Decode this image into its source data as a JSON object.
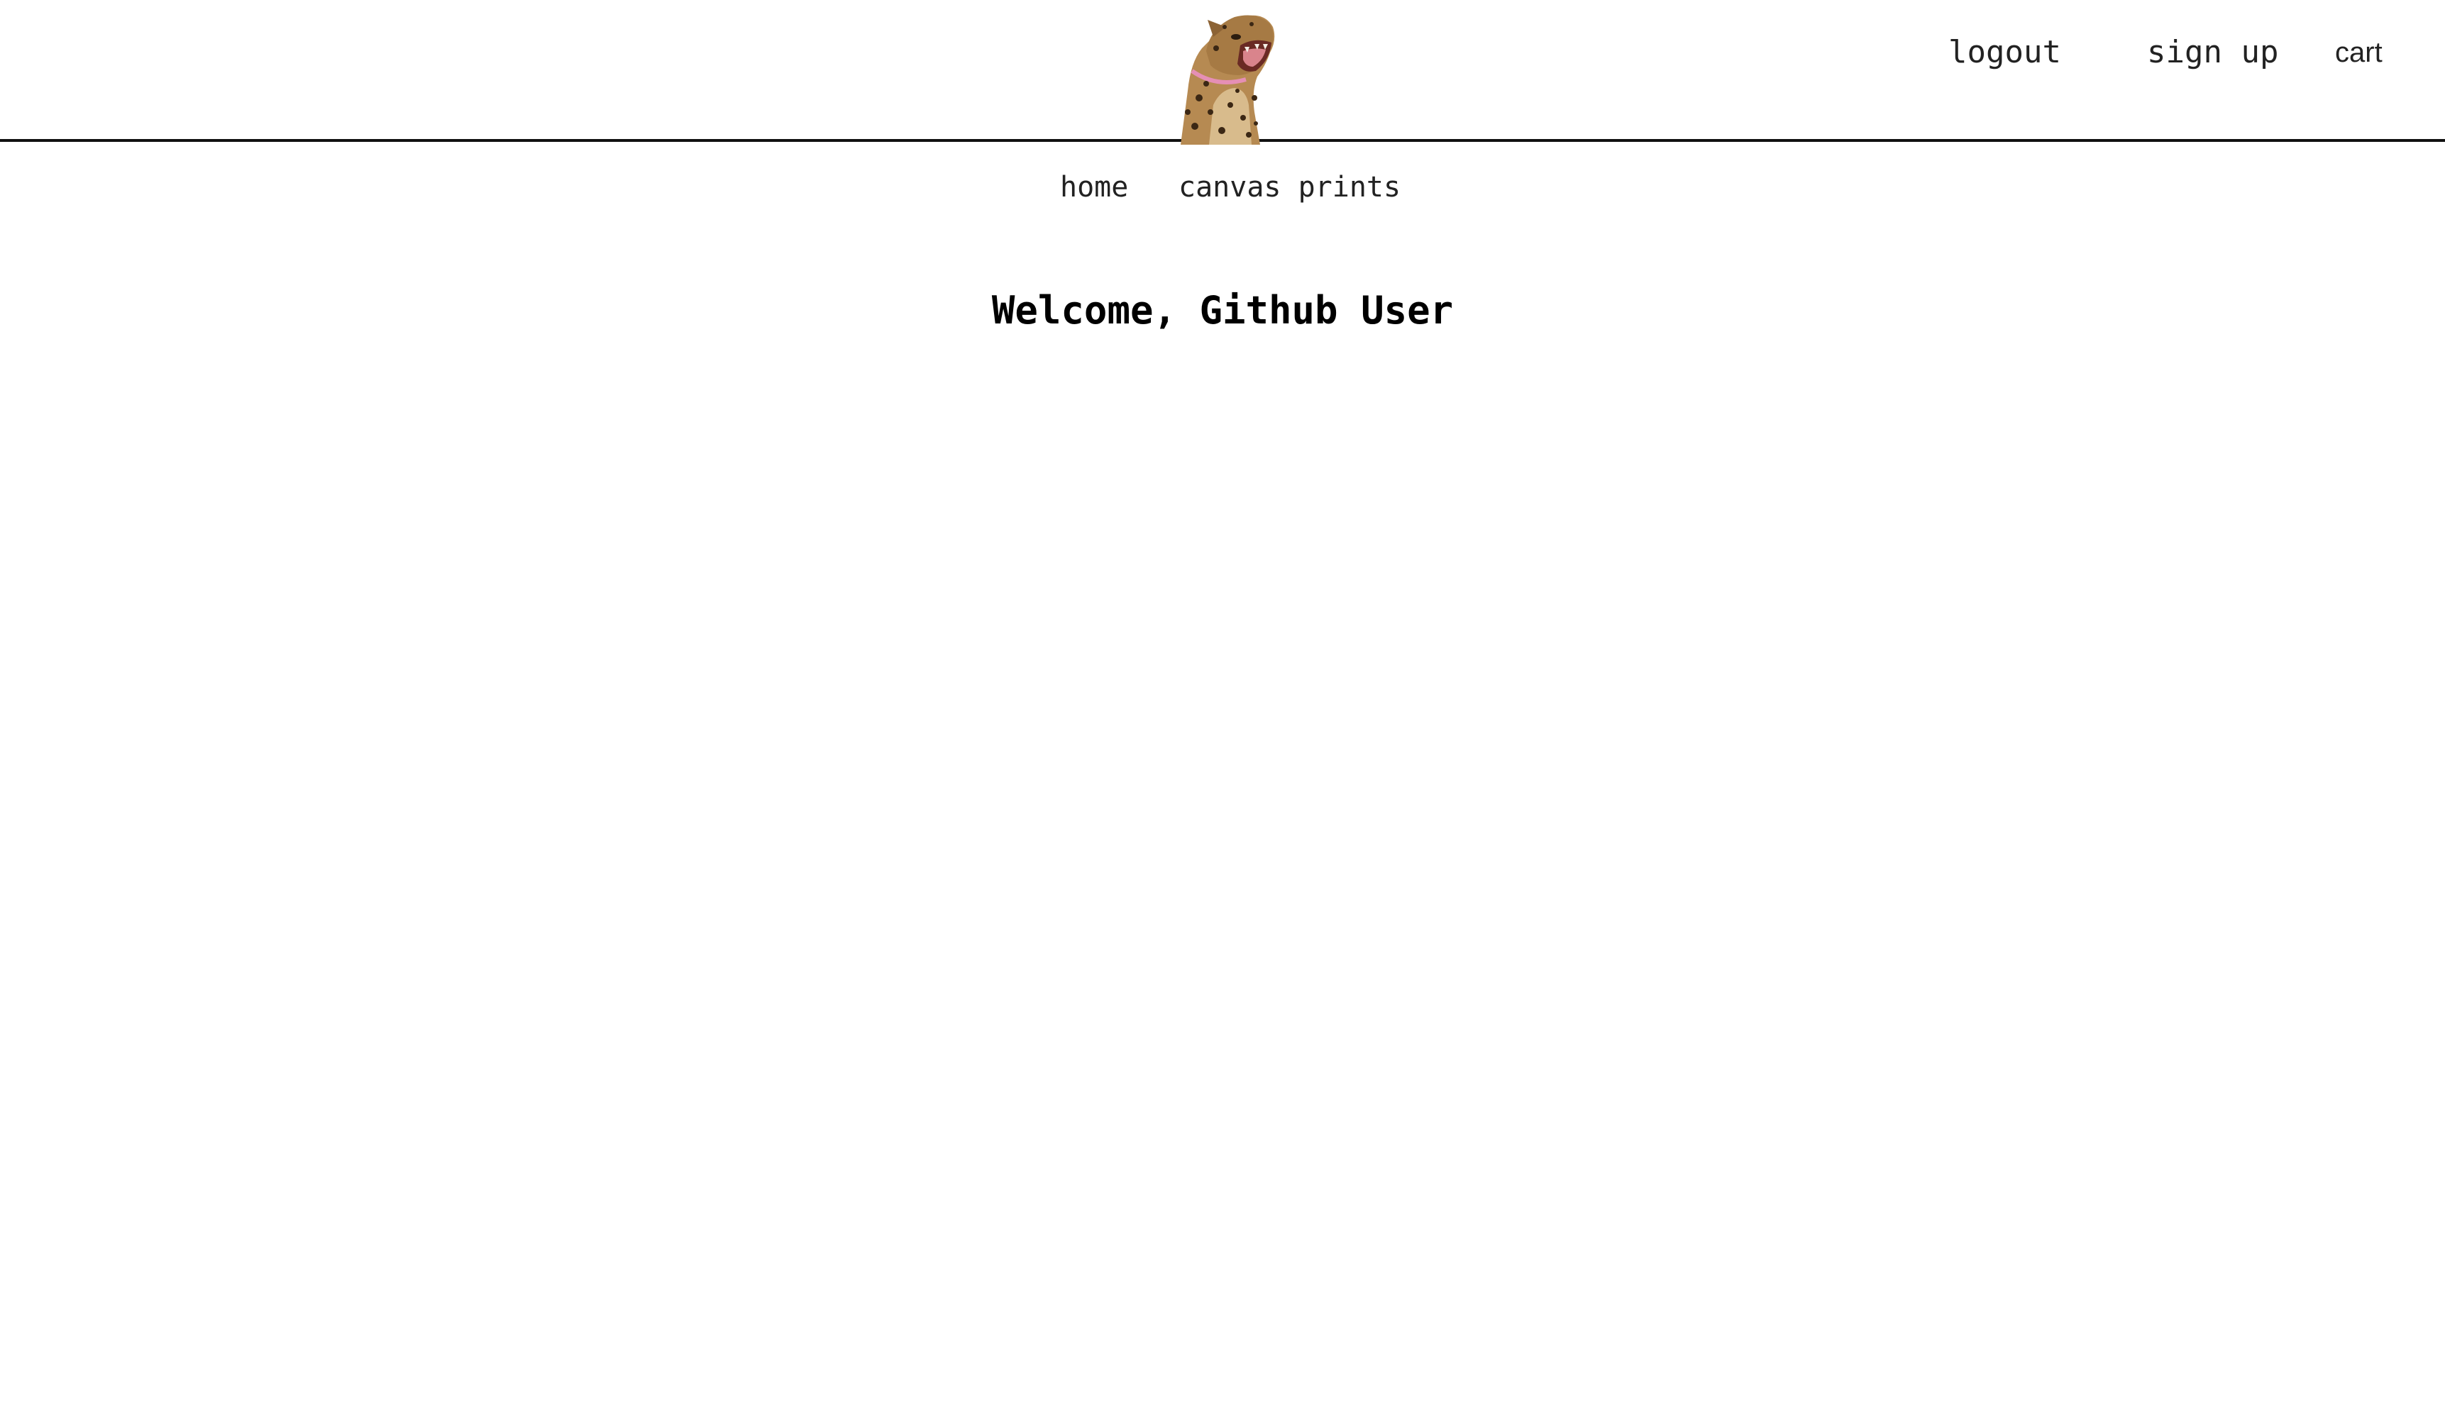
{
  "header": {
    "logo_alt": "leopard logo",
    "auth_links": {
      "logout": "logout",
      "sign_up": "sign up",
      "cart": "cart"
    }
  },
  "nav": {
    "items": [
      {
        "label": "home"
      },
      {
        "label": "canvas prints"
      }
    ]
  },
  "main": {
    "welcome": "Welcome, Github User"
  },
  "icons": {
    "logo": "leopard-logo-icon"
  },
  "colors": {
    "text": "#111111",
    "background": "#ffffff",
    "header_rule": "#111111"
  }
}
